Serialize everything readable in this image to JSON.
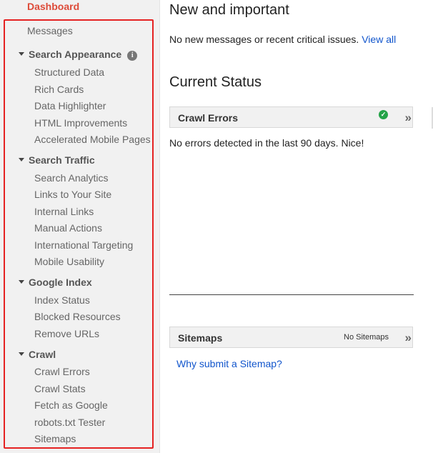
{
  "sidebar": {
    "dashboard": "Dashboard",
    "messages": "Messages",
    "sections": [
      {
        "label": "Search Appearance",
        "items": [
          "Structured Data",
          "Rich Cards",
          "Data Highlighter",
          "HTML Improvements",
          "Accelerated Mobile Pages"
        ]
      },
      {
        "label": "Search Traffic",
        "items": [
          "Search Analytics",
          "Links to Your Site",
          "Internal Links",
          "Manual Actions",
          "International Targeting",
          "Mobile Usability"
        ]
      },
      {
        "label": "Google Index",
        "items": [
          "Index Status",
          "Blocked Resources",
          "Remove URLs"
        ]
      },
      {
        "label": "Crawl",
        "items": [
          "Crawl Errors",
          "Crawl Stats",
          "Fetch as Google",
          "robots.txt Tester",
          "Sitemaps"
        ]
      }
    ],
    "info_glyph": "i",
    "highlight_color": "#e52222"
  },
  "main": {
    "new_title": "New and important",
    "no_messages": "No new messages or recent critical issues.",
    "view_all": "View all",
    "status_title": "Current Status",
    "crawl_panel": {
      "title": "Crawl Errors",
      "chevron": "»",
      "status_icon": "check-circle-icon",
      "status_color": "#24a348"
    },
    "crawl_message": "No errors detected in the last 90 days. Nice!",
    "sitemaps_panel": {
      "title": "Sitemaps",
      "note": "No Sitemaps",
      "chevron": "»"
    },
    "sitemap_link": "Why submit a Sitemap?"
  },
  "colors": {
    "accent": "#dd4b39",
    "link": "#1155cc"
  }
}
